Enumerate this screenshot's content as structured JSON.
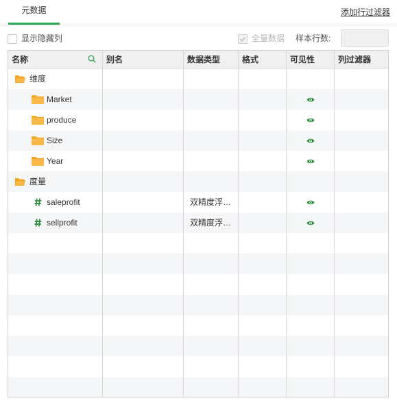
{
  "tabs": [
    {
      "label": "元数据"
    }
  ],
  "add_row_filter_label": "添加行过滤器",
  "options": {
    "show_hidden_label": "显示隐藏列",
    "show_hidden_checked": false,
    "full_data_label": "全量数据",
    "full_data_checked": true,
    "sample_rows_label": "样本行数:",
    "sample_rows_value": ""
  },
  "columns": [
    "名称",
    "别名",
    "数据类型",
    "格式",
    "可见性",
    "列过滤器"
  ],
  "groups": [
    {
      "label": "维度",
      "icon": "folder-open-icon",
      "items": [
        {
          "name": "Market",
          "icon": "folder-icon",
          "data_type": "",
          "visible": true
        },
        {
          "name": "produce",
          "icon": "folder-icon",
          "data_type": "",
          "visible": true
        },
        {
          "name": "Size",
          "icon": "folder-icon",
          "data_type": "",
          "visible": true
        },
        {
          "name": "Year",
          "icon": "folder-icon",
          "data_type": "",
          "visible": true
        }
      ]
    },
    {
      "label": "度量",
      "icon": "folder-open-icon",
      "items": [
        {
          "name": "saleprofit",
          "icon": "hash-icon",
          "data_type": "双精度浮…",
          "visible": true
        },
        {
          "name": "sellprofit",
          "icon": "hash-icon",
          "data_type": "双精度浮…",
          "visible": true
        }
      ]
    }
  ],
  "colors": {
    "accent": "#2ea650",
    "folder": "#f5a623",
    "eye": "#2f8a3c",
    "hash": "#2f8a3c",
    "stripe": "#f5f6f8"
  }
}
